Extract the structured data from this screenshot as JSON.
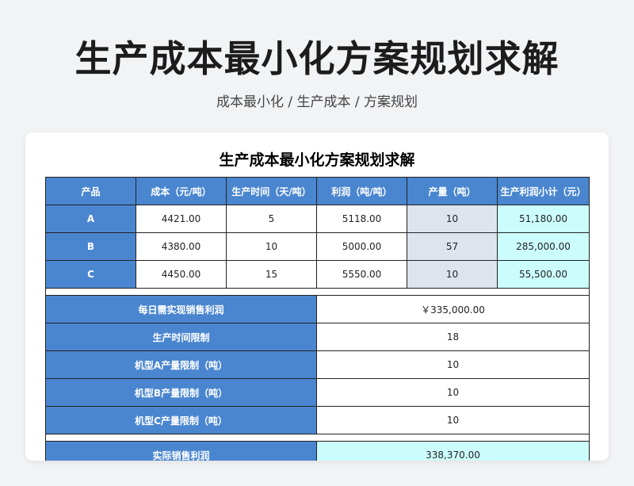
{
  "page": {
    "title": "生产成本最小化方案规划求解",
    "subtitle": "成本最小化 / 生产成本 / 方案规划"
  },
  "sheet": {
    "title": "生产成本最小化方案规划求解",
    "headers": [
      "产品",
      "成本（元/吨）",
      "生产时间（天/吨）",
      "利润（吨/吨）",
      "产量（吨）",
      "生产利润小计（元）"
    ],
    "rows": [
      [
        "A",
        "4421.00",
        "5",
        "5118.00",
        "10",
        "51,180.00"
      ],
      [
        "B",
        "4380.00",
        "10",
        "5000.00",
        "57",
        "285,000.00"
      ],
      [
        "C",
        "4450.00",
        "15",
        "5550.00",
        "10",
        "55,500.00"
      ]
    ],
    "constraints": [
      {
        "label": "每日需实现销售利润",
        "value": "￥335,000.00"
      },
      {
        "label": "生产时间限制",
        "value": "18"
      },
      {
        "label": "机型A产量限制（吨）",
        "value": "10"
      },
      {
        "label": "机型B产量限制（吨）",
        "value": "10"
      },
      {
        "label": "机型C产量限制（吨）",
        "value": "10"
      }
    ],
    "result": {
      "label": "实际销售利润",
      "value": "338,370.00"
    }
  }
}
